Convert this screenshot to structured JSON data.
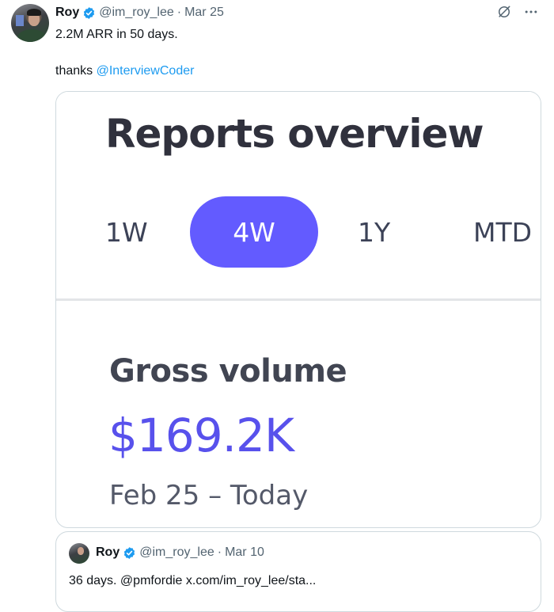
{
  "tweet": {
    "author_name": "Roy",
    "handle": "@im_roy_lee",
    "separator": "·",
    "date": "Mar 25",
    "text_line1": "2.2M ARR in 50 days.",
    "text_line2_prefix": "thanks ",
    "text_line2_mention": "@InterviewCoder"
  },
  "media": {
    "title": "Reports overview",
    "tabs": [
      "1W",
      "4W",
      "1Y",
      "MTD"
    ],
    "selected_tab": "4W",
    "metric_label": "Gross volume",
    "metric_value": "$169.2K",
    "date_range": "Feb 25 – Today"
  },
  "quoted_tweet": {
    "author_name": "Roy",
    "handle": "@im_roy_lee",
    "separator": "·",
    "date": "Mar 10",
    "text": "36 days. @pmfordie x.com/im_roy_lee/sta..."
  },
  "icons": {
    "verified": "verified-badge-icon",
    "grok": "grok-icon",
    "more": "more-icon"
  },
  "colors": {
    "link": "#1d9bf0",
    "verified": "#1d9bf0",
    "accent": "#635bff",
    "metric_value": "#5851ec"
  }
}
